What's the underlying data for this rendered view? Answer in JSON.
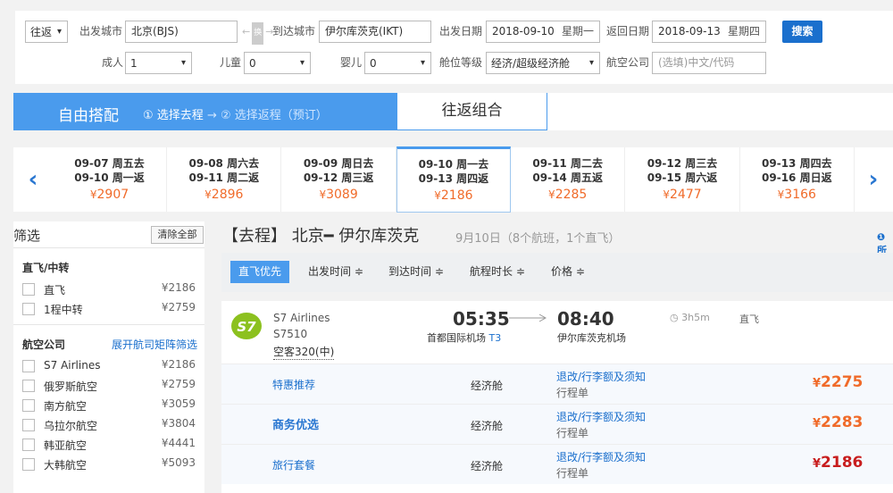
{
  "search": {
    "trip_type": "往返",
    "from_label": "出发城市",
    "from_value": "北京(BJS)",
    "swap_label": "换",
    "to_label": "到达城市",
    "to_value": "伊尔库茨克(IKT)",
    "depart_label": "出发日期",
    "depart_date": "2018-09-10",
    "depart_weekday": "星期一",
    "return_label": "返回日期",
    "return_date": "2018-09-13",
    "return_weekday": "星期四",
    "search_button": "搜索",
    "adult_label": "成人",
    "adult_value": "1",
    "child_label": "儿童",
    "child_value": "0",
    "infant_label": "婴儿",
    "infant_value": "0",
    "cabin_label": "舱位等级",
    "cabin_value": "经济/超级经济舱",
    "airline_label": "航空公司",
    "airline_placeholder": "(选填)中文/代码"
  },
  "mode": {
    "free_title": "自由搭配",
    "step1": "① 选择去程",
    "step_arrow": "→",
    "step2": "② 选择返程（预订）",
    "round_title": "往返组合"
  },
  "dates": [
    {
      "go": "09-07 周五去",
      "ret": "09-10 周一返",
      "price": "2907"
    },
    {
      "go": "09-08 周六去",
      "ret": "09-11 周二返",
      "price": "2896"
    },
    {
      "go": "09-09 周日去",
      "ret": "09-12 周三返",
      "price": "3089"
    },
    {
      "go": "09-10 周一去",
      "ret": "09-13 周四返",
      "price": "2186"
    },
    {
      "go": "09-11 周二去",
      "ret": "09-14 周五返",
      "price": "2285"
    },
    {
      "go": "09-12 周三去",
      "ret": "09-15 周六返",
      "price": "2477"
    },
    {
      "go": "09-13 周四去",
      "ret": "09-16 周日返",
      "price": "3166"
    }
  ],
  "currency": "¥",
  "filter": {
    "title": "筛选",
    "clear_all": "清除全部",
    "direct_group": "直飞/中转",
    "direct_items": [
      {
        "name": "直飞",
        "price": "¥2186"
      },
      {
        "name": "1程中转",
        "price": "¥2759"
      }
    ],
    "airline_group": "航空公司",
    "airline_link": "展开航司矩阵筛选",
    "airline_items": [
      {
        "name": "S7 Airlines",
        "price": "¥2186"
      },
      {
        "name": "俄罗斯航空",
        "price": "¥2759"
      },
      {
        "name": "南方航空",
        "price": "¥3059"
      },
      {
        "name": "乌拉尔航空",
        "price": "¥3804"
      },
      {
        "name": "韩亚航空",
        "price": "¥4441"
      },
      {
        "name": "大韩航空",
        "price": "¥5093"
      }
    ]
  },
  "results": {
    "title": "【去程】 北京━ 伊尔库茨克",
    "subtitle": "9月10日（8个航班，1个直飞）",
    "info_glyph": "❶所"
  },
  "sort": {
    "direct_first": "直飞优先",
    "depart_time": "出发时间 ≑",
    "arrive_time": "到达时间 ≑",
    "duration": "航程时长 ≑",
    "price": "价格 ≑"
  },
  "flight": {
    "logo_text": "S7",
    "airline": "S7 Airlines",
    "number": "S7510",
    "aircraft": "空客320(中)",
    "dep_time": "05:35",
    "dep_airport": "首都国际机场",
    "dep_terminal": "T3",
    "arr_time": "08:40",
    "arr_airport": "伊尔库茨克机场",
    "duration": "◷ 3h5m",
    "stop": "直飞",
    "fares": [
      {
        "product": "特惠推荐",
        "cabin": "经济舱",
        "rule": "退改/行李额及须知",
        "ticket": "行程单",
        "price": "2275",
        "red": false,
        "brand": false
      },
      {
        "product": "商务优选",
        "cabin": "经济舱",
        "rule": "退改/行李额及须知",
        "ticket": "行程单",
        "price": "2283",
        "red": false,
        "brand": true
      },
      {
        "product": "旅行套餐",
        "cabin": "经济舱",
        "rule": "退改/行李额及须知",
        "ticket": "行程单",
        "price": "2186",
        "red": true,
        "brand": false
      }
    ]
  },
  "colors": {
    "primary": "#4a9bed",
    "link": "#1a6fcd",
    "price_orange": "#f06b2a",
    "price_red": "#c81e1e",
    "logo_green": "#8cc11f"
  }
}
